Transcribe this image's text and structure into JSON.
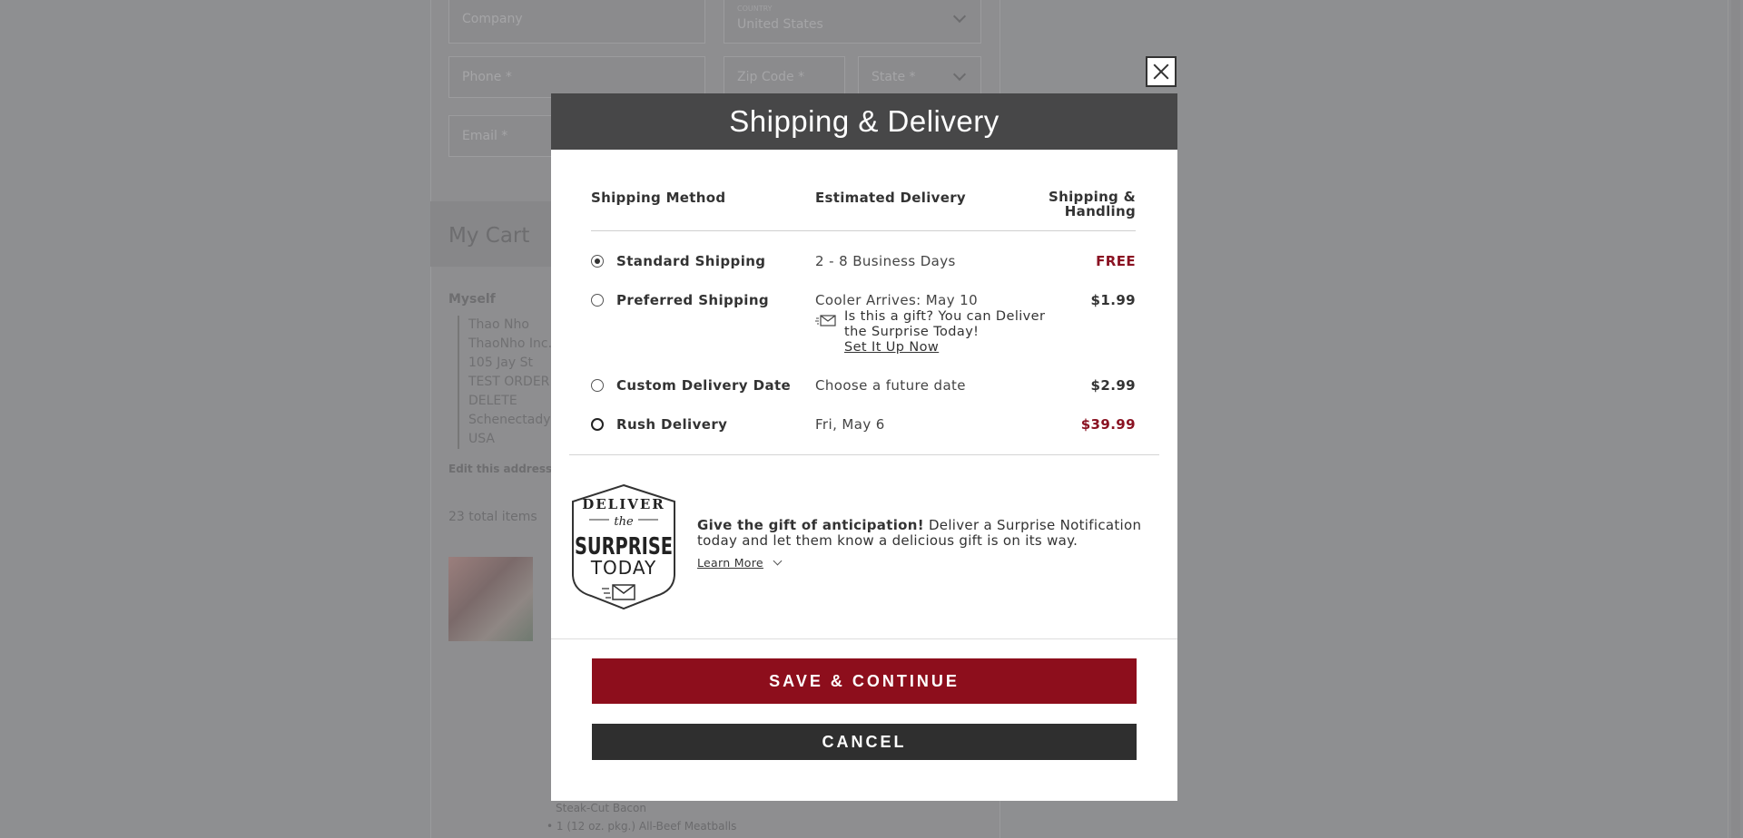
{
  "background": {
    "company_placeholder": "Company",
    "country_label": "COUNTRY",
    "country_value": "United States",
    "phone_placeholder": "Phone *",
    "zip_placeholder": "Zip Code *",
    "state_placeholder": "State *",
    "email_placeholder": "Email *",
    "cart_title": "My Cart",
    "recipient_label": "Myself",
    "address_lines": [
      "Thao Nho",
      "ThaoNho Inc.",
      "105 Jay St",
      "TEST ORDER",
      "DELETE",
      "Schenectady,",
      "USA"
    ],
    "edit_address": "Edit this address",
    "total_items": "23 total items",
    "item_line_1": "Steak-Cut Bacon",
    "item_line_2": "• 1 (12 oz. pkg.) All-Beef Meatballs"
  },
  "modal": {
    "title": "Shipping & Delivery",
    "headers": {
      "method": "Shipping Method",
      "delivery": "Estimated Delivery",
      "fee_line1": "Shipping &",
      "fee_line2": "Handling"
    },
    "options": [
      {
        "name": "Standard Shipping",
        "estimate": "2 - 8 Business Days",
        "fee": "FREE",
        "selected": true
      },
      {
        "name": "Preferred Shipping",
        "estimate": "Cooler Arrives: May 10",
        "fee": "$1.99",
        "selected": false,
        "gift_text": "Is this a gift? You can Deliver the Surprise Today!",
        "gift_link": "Set It Up Now"
      },
      {
        "name": "Custom Delivery Date",
        "estimate": "Choose a future date",
        "fee": "$2.99",
        "selected": false
      },
      {
        "name": "Rush Delivery",
        "estimate": "Fri, May 6",
        "fee": "$39.99",
        "selected": false
      }
    ],
    "badge": {
      "line1": "DELIVER",
      "line2": "the",
      "line3": "SURPRISE",
      "line4": "TODAY"
    },
    "promo_bold": "Give the gift of anticipation!",
    "promo_text": " Deliver a Surprise Notification today and let them know a delicious gift is on its way.",
    "learn_more": "Learn More",
    "save_button": "SAVE & CONTINUE",
    "cancel_button": "CANCEL"
  },
  "colors": {
    "accent_red": "#8d0e1c",
    "header_bg": "#474748",
    "cancel_bg": "#2f2f2f",
    "overlay": "#8e8f91"
  }
}
